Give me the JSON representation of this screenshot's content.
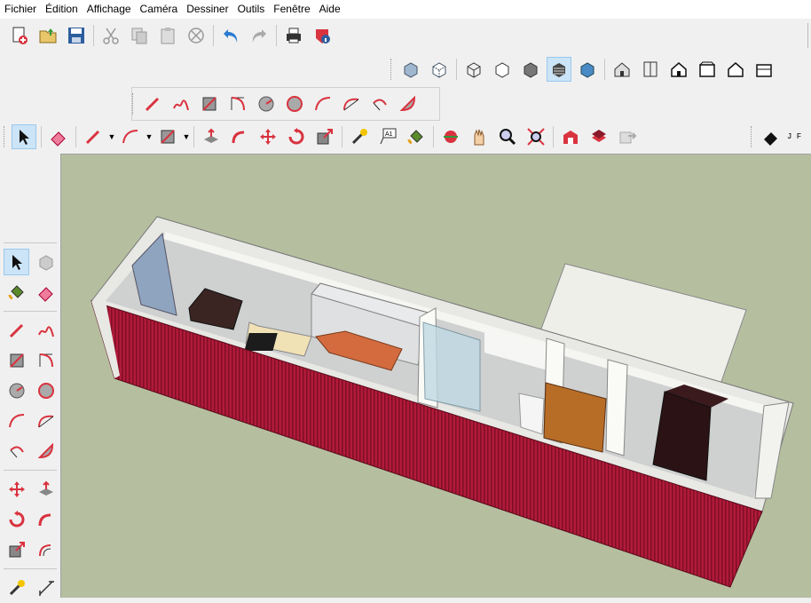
{
  "menu": [
    "Fichier",
    "Édition",
    "Affichage",
    "Caméra",
    "Dessiner",
    "Outils",
    "Fenêtre",
    "Aide"
  ],
  "style_tb_label": "J F",
  "icons": {
    "standard": [
      "new-file-icon",
      "open-folder-icon",
      "save-icon",
      "cut-icon",
      "copy-icon",
      "paste-icon",
      "erase-icon",
      "undo-icon",
      "redo-icon",
      "print-icon",
      "model-info-icon"
    ],
    "views": [
      "iso-view-icon",
      "top-view-icon",
      "front-view-icon",
      "right-view-icon",
      "back-view-icon",
      "left-view-icon"
    ],
    "display": [
      "xray-icon",
      "back-edges-icon",
      "wireframe-icon",
      "hidden-line-icon",
      "shaded-icon",
      "shaded-textures-icon",
      "monochrome-icon"
    ],
    "drawing": [
      "line-icon",
      "freehand-icon",
      "rectangle-icon",
      "rotated-rectangle-icon",
      "circle-icon",
      "polygon-icon",
      "arc-icon",
      "two-point-arc-icon",
      "three-point-arc-icon",
      "pie-icon"
    ]
  },
  "colors": {
    "viewport_bg": "#b5bfa0",
    "container_red": "#b21a3a",
    "icon_red": "#d9333f"
  }
}
